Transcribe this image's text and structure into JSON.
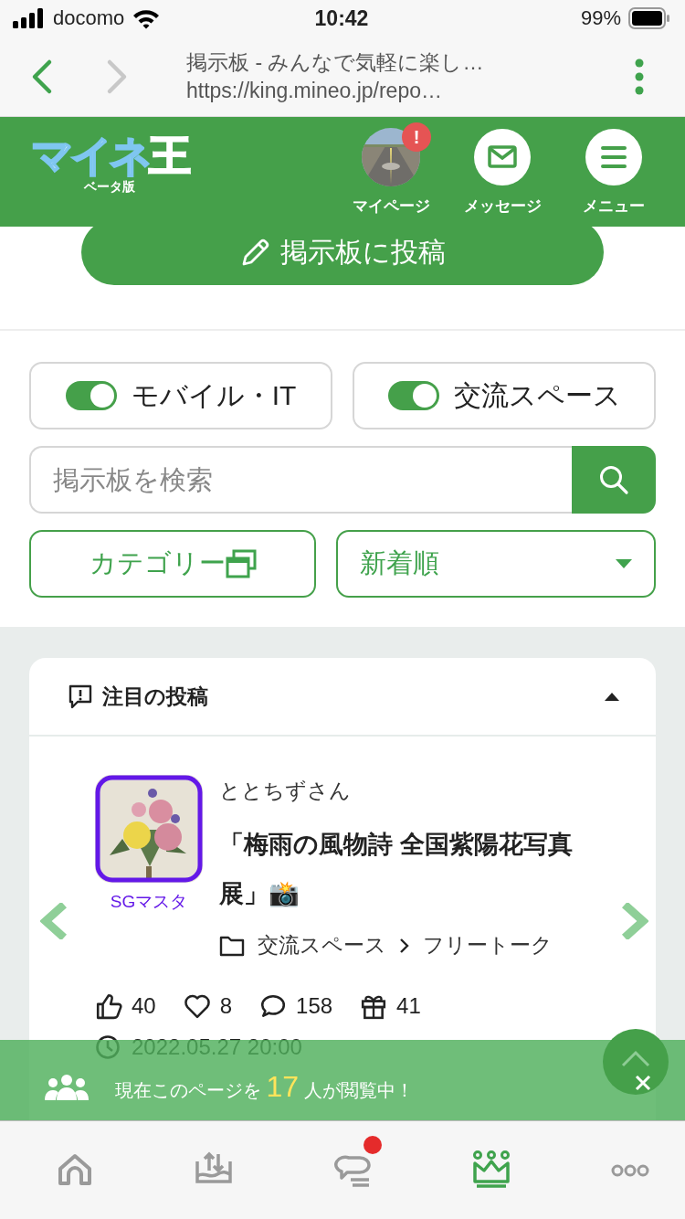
{
  "status_bar": {
    "carrier": "docomo",
    "time": "10:42",
    "battery": "99%"
  },
  "browser": {
    "title": "掲示板 - みんなで気軽に楽し…",
    "url": "https://king.mineo.jp/repo…"
  },
  "header": {
    "logo": "マイネ王",
    "logo_sub": "ベータ版",
    "nav": [
      {
        "kind": "avatar",
        "label": "マイページ",
        "alert": "!"
      },
      {
        "kind": "message",
        "label": "メッセージ"
      },
      {
        "kind": "menu",
        "label": "メニュー"
      }
    ]
  },
  "post_button": "掲示板に投稿",
  "filters": [
    {
      "label": "モバイル・IT",
      "on": true
    },
    {
      "label": "交流スペース",
      "on": true
    }
  ],
  "search": {
    "placeholder": "掲示板を検索"
  },
  "category_button": "カテゴリー",
  "sort": {
    "value": "新着順"
  },
  "featured": {
    "title": "注目の投稿",
    "expanded": true,
    "post": {
      "author": "ととちずさん",
      "badge": "SGマスタ",
      "title": "「梅雨の風物詩 全国紫陽花写真展」📸",
      "path": [
        "交流スペース",
        "フリートーク"
      ],
      "stats": [
        {
          "kind": "like",
          "value": "40"
        },
        {
          "kind": "heart",
          "value": "8"
        },
        {
          "kind": "comment",
          "value": "158"
        },
        {
          "kind": "gift",
          "value": "41"
        }
      ],
      "date": "2022.05.27 20:00"
    }
  },
  "banner": {
    "prefix": "現在このページを",
    "count": "17",
    "suffix": "人が閲覧中！"
  },
  "tab_bar": [
    {
      "kind": "home",
      "selected": false,
      "badge": false
    },
    {
      "kind": "transfer",
      "selected": false,
      "badge": false
    },
    {
      "kind": "chat",
      "selected": false,
      "badge": true
    },
    {
      "kind": "crown",
      "selected": true,
      "badge": false
    },
    {
      "kind": "more",
      "selected": false,
      "badge": false
    }
  ]
}
